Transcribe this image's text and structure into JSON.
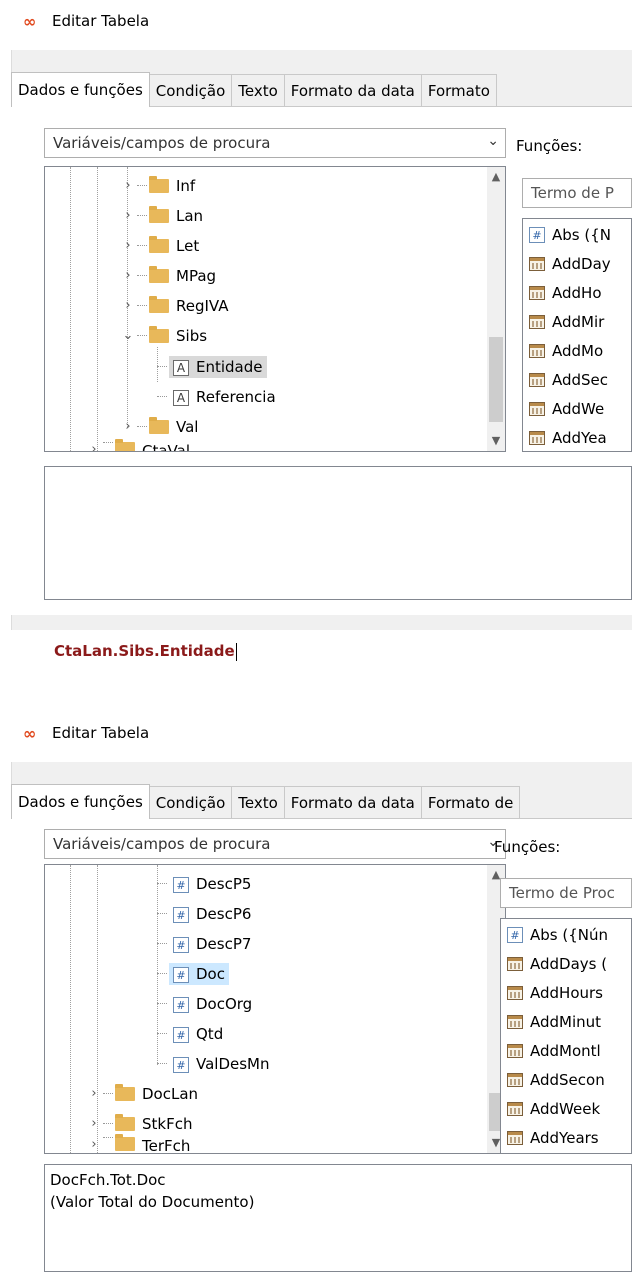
{
  "top": {
    "window": {
      "title": "Editar Tabela",
      "logo": "∞"
    },
    "tabs": [
      "Dados e funções",
      "Condição",
      "Texto",
      "Formato da data",
      "Formato"
    ],
    "search_combo": {
      "placeholder": "Variáveis/campos de procura"
    },
    "functions_label": "Funções:",
    "fn_search_placeholder": "Termo de P",
    "tree": {
      "items": [
        {
          "label": "Inf",
          "kind": "folder",
          "expander": "›"
        },
        {
          "label": "Lan",
          "kind": "folder",
          "expander": "›"
        },
        {
          "label": "Let",
          "kind": "folder",
          "expander": "›"
        },
        {
          "label": "MPag",
          "kind": "folder",
          "expander": "›"
        },
        {
          "label": "RegIVA",
          "kind": "folder",
          "expander": "›"
        },
        {
          "label": "Sibs",
          "kind": "folder",
          "expander": "⌄"
        },
        {
          "label": "Entidade",
          "kind": "field",
          "selected": true
        },
        {
          "label": "Referencia",
          "kind": "field"
        },
        {
          "label": "Val",
          "kind": "folder",
          "expander": "›"
        },
        {
          "label": "CtaVal",
          "kind": "folder",
          "expander": "›"
        }
      ]
    },
    "functions": [
      "Abs ({N",
      "AddDay",
      "AddHo",
      "AddMir",
      "AddMo",
      "AddSec",
      "AddWe",
      "AddYea"
    ],
    "description": "",
    "expression": "CtaLan.Sibs.Entidade"
  },
  "bottom": {
    "window": {
      "title": "Editar Tabela",
      "logo": "∞"
    },
    "tabs": [
      "Dados e funções",
      "Condição",
      "Texto",
      "Formato da data",
      "Formato de"
    ],
    "search_combo": {
      "placeholder": "Variáveis/campos de procura"
    },
    "functions_label": "Funções:",
    "fn_search_placeholder": "Termo de Proc",
    "tree": {
      "items": [
        {
          "label": "DescP5",
          "kind": "num"
        },
        {
          "label": "DescP6",
          "kind": "num"
        },
        {
          "label": "DescP7",
          "kind": "num"
        },
        {
          "label": "Doc",
          "kind": "num",
          "selected": true
        },
        {
          "label": "DocOrg",
          "kind": "num"
        },
        {
          "label": "Qtd",
          "kind": "num"
        },
        {
          "label": "ValDesMn",
          "kind": "num"
        },
        {
          "label": "DocLan",
          "kind": "folder",
          "expander": "›"
        },
        {
          "label": "StkFch",
          "kind": "folder",
          "expander": "›"
        },
        {
          "label": "TerFch",
          "kind": "folder",
          "expander": "›"
        }
      ]
    },
    "functions": [
      "Abs ({Nún",
      "AddDays (",
      "AddHours",
      "AddMinut",
      "AddMontl",
      "AddSecon",
      "AddWeek",
      "AddYears"
    ],
    "description_line1": "DocFch.Tot.Doc",
    "description_line2": "(Valor Total do Documento)"
  }
}
